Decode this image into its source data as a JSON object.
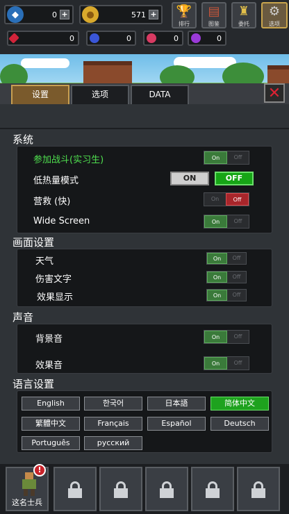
{
  "top": {
    "diamond": "0",
    "gold": "571",
    "menu": [
      {
        "label": "排行",
        "icon": "trophy-icon"
      },
      {
        "label": "图鉴",
        "icon": "book-icon"
      },
      {
        "label": "委托",
        "icon": "banner-icon"
      },
      {
        "label": "选项",
        "icon": "gear-icon"
      }
    ],
    "gems": [
      "0",
      "0",
      "0",
      "0"
    ]
  },
  "tabs": [
    "设置",
    "选项",
    "DATA"
  ],
  "sections": {
    "system": {
      "title": "系统",
      "rows": [
        {
          "label": "参加战斗(实习生)"
        },
        {
          "label": "低热量模式"
        },
        {
          "label": "营救 (快)"
        },
        {
          "label": "Wide Screen"
        }
      ]
    },
    "graphics": {
      "title": "画面设置",
      "rows": [
        {
          "label": "天气"
        },
        {
          "label": "伤害文字"
        },
        {
          "label": "效果显示"
        }
      ]
    },
    "sound": {
      "title": "声音",
      "rows": [
        {
          "label": "背景音"
        },
        {
          "label": "效果音"
        }
      ]
    },
    "language": {
      "title": "语言设置",
      "options": [
        "English",
        "한국어",
        "日本語",
        "简体中文",
        "繁體中文",
        "Français",
        "Español",
        "Deutsch",
        "Português",
        "русский"
      ],
      "selected": "简体中文"
    }
  },
  "toggle_text": {
    "on": "On",
    "off": "Off",
    "big_on": "ON",
    "big_off": "OFF"
  },
  "bottom": {
    "slot1_label": "这名士兵",
    "alert": "!"
  }
}
